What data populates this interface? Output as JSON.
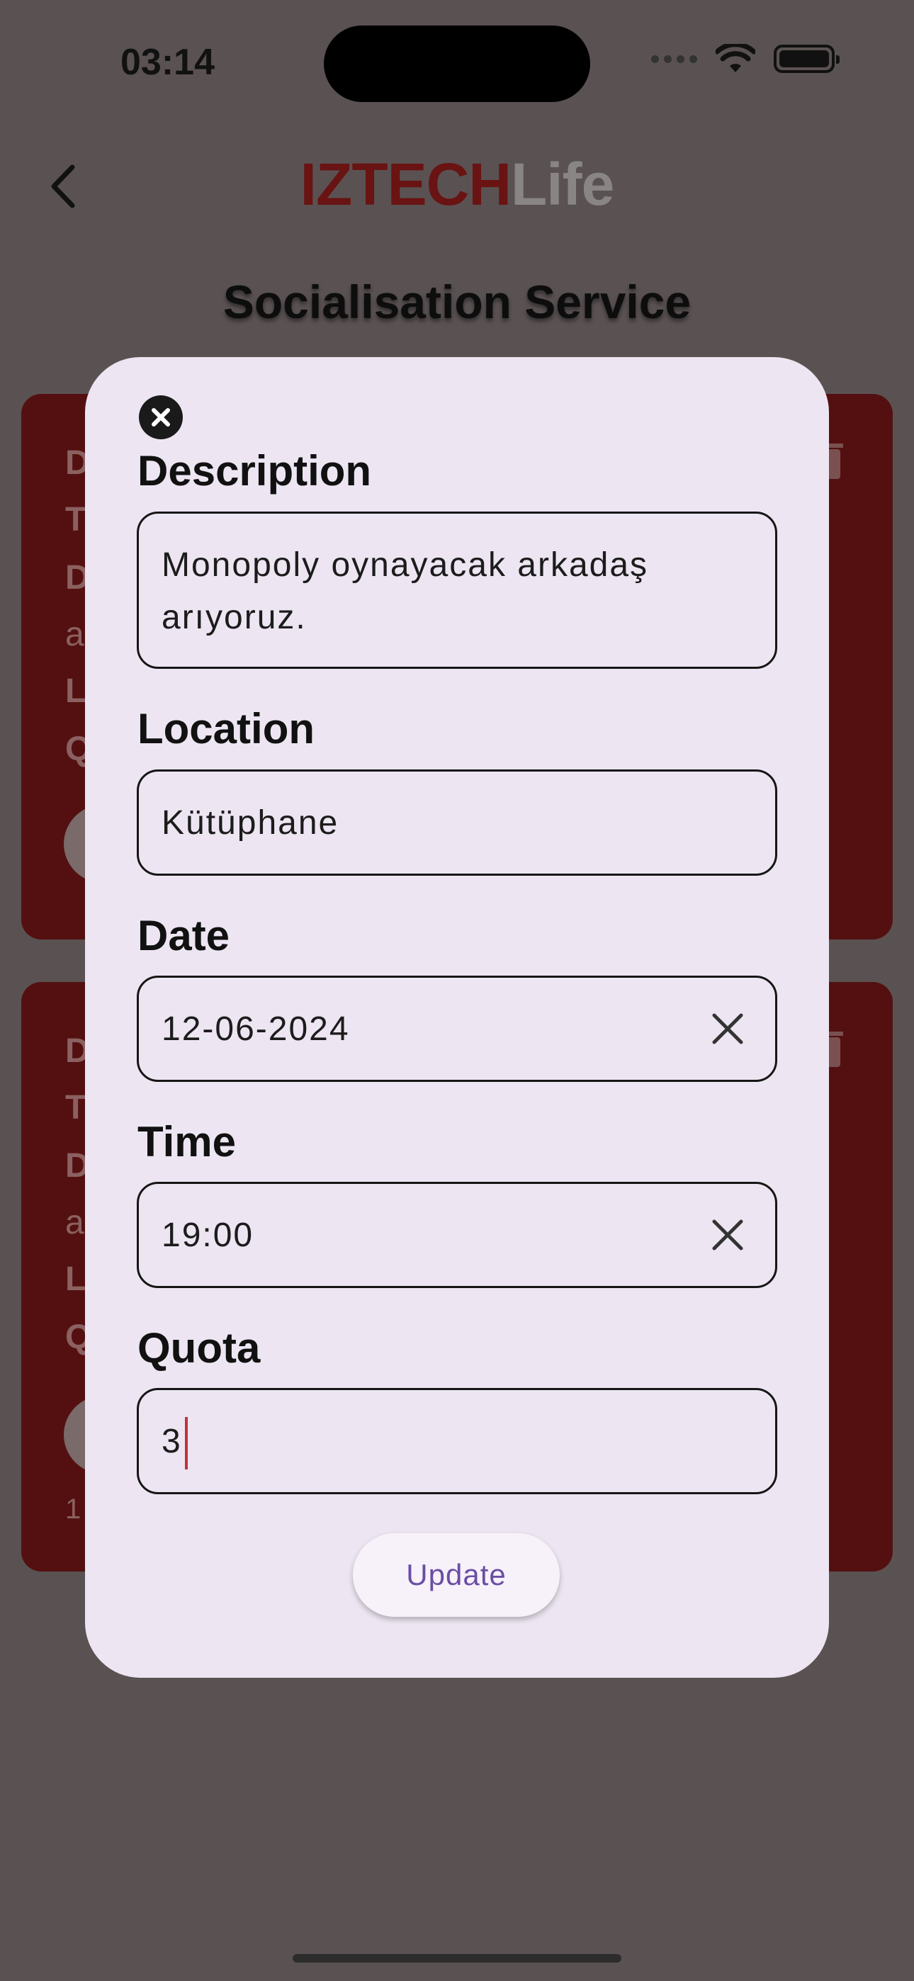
{
  "status_bar": {
    "time": "03:14"
  },
  "header": {
    "brand_part1": "IZTECH",
    "brand_part2": "Life",
    "title": "Socialisation Service"
  },
  "background_cards": [
    {
      "letters": [
        "D",
        "T",
        "D",
        "a",
        "L",
        "Q"
      ]
    },
    {
      "letters": [
        "D",
        "T",
        "D",
        "a",
        "L",
        "Q"
      ],
      "footer": "1"
    }
  ],
  "modal": {
    "description": {
      "label": "Description",
      "value_line1": "Monopoly oynayacak arkadaş",
      "value_line2": "arıyoruz."
    },
    "location": {
      "label": "Location",
      "value": "Kütüphane"
    },
    "date": {
      "label": "Date",
      "value": "12-06-2024"
    },
    "time": {
      "label": "Time",
      "value": "19:00"
    },
    "quota": {
      "label": "Quota",
      "value": "3"
    },
    "update_label": "Update"
  },
  "colors": {
    "brand_dark": "#6a1313",
    "card_bg": "#541010",
    "modal_bg": "#ede6f2",
    "button_text": "#6a4ea3",
    "cursor": "#c0323a"
  }
}
